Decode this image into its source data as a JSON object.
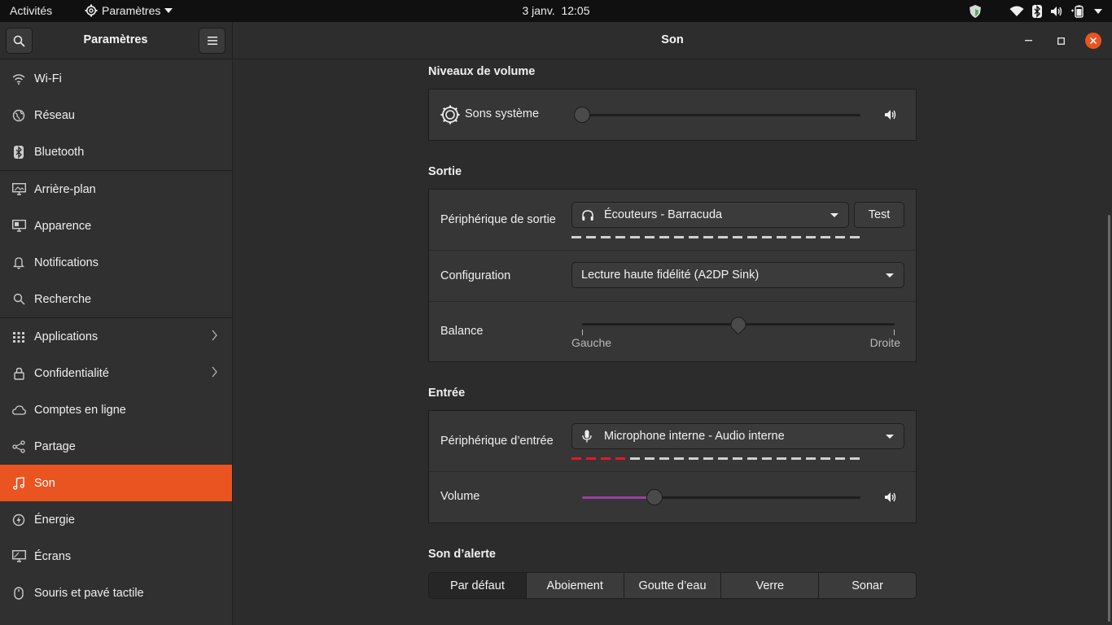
{
  "topbar": {
    "activities": "Activités",
    "app_menu": "Paramètres",
    "date": "3 janv.",
    "time": "12:05",
    "tray_icons": [
      "shield-icon",
      "wifi-icon",
      "bluetooth-icon",
      "speaker-icon",
      "battery-icon",
      "caret-down-icon"
    ]
  },
  "sidebar": {
    "title": "Paramètres",
    "items": [
      {
        "label": "Wi-Fi",
        "icon": "wifi-icon"
      },
      {
        "label": "Réseau",
        "icon": "network-icon"
      },
      {
        "label": "Bluetooth",
        "icon": "bluetooth-icon"
      },
      {
        "label": "Arrière-plan",
        "icon": "background-icon"
      },
      {
        "label": "Apparence",
        "icon": "appearance-icon"
      },
      {
        "label": "Notifications",
        "icon": "bell-icon"
      },
      {
        "label": "Recherche",
        "icon": "search-icon"
      },
      {
        "label": "Applications",
        "icon": "apps-grid-icon"
      },
      {
        "label": "Confidentialité",
        "icon": "lock-icon"
      },
      {
        "label": "Comptes en ligne",
        "icon": "cloud-icon"
      },
      {
        "label": "Partage",
        "icon": "share-icon"
      },
      {
        "label": "Son",
        "icon": "music-note-icon"
      },
      {
        "label": "Énergie",
        "icon": "power-icon"
      },
      {
        "label": "Écrans",
        "icon": "display-icon"
      },
      {
        "label": "Souris et pavé tactile",
        "icon": "mouse-icon"
      }
    ],
    "active_index": 11
  },
  "window": {
    "title": "Son"
  },
  "volume_levels": {
    "heading": "Niveaux de volume",
    "system_sounds_label": "Sons système",
    "system_sounds_level": 0
  },
  "output": {
    "heading": "Sortie",
    "device_label": "Périphérique de sortie",
    "device_value": "Écouteurs - Barracuda",
    "test_button": "Test",
    "configuration_label": "Configuration",
    "configuration_value": "Lecture haute fidélité (A2DP Sink)",
    "balance_label": "Balance",
    "balance_left": "Gauche",
    "balance_right": "Droite",
    "balance_value": 0.5
  },
  "input": {
    "heading": "Entrée",
    "device_label": "Périphérique d’entrée",
    "device_value": "Microphone interne - Audio interne",
    "volume_label": "Volume",
    "volume_level": 0.26,
    "input_level_segments_active": 4,
    "input_level_segments_total": 20
  },
  "alert": {
    "heading": "Son d’alerte",
    "options": [
      "Par défaut",
      "Aboiement",
      "Goutte d’eau",
      "Verre",
      "Sonar"
    ],
    "selected_index": 0
  },
  "colors": {
    "accent": "#e95420",
    "close_button": "#e95420",
    "input_level": "#e01b24",
    "volume_fill": "#9a3fa0"
  }
}
